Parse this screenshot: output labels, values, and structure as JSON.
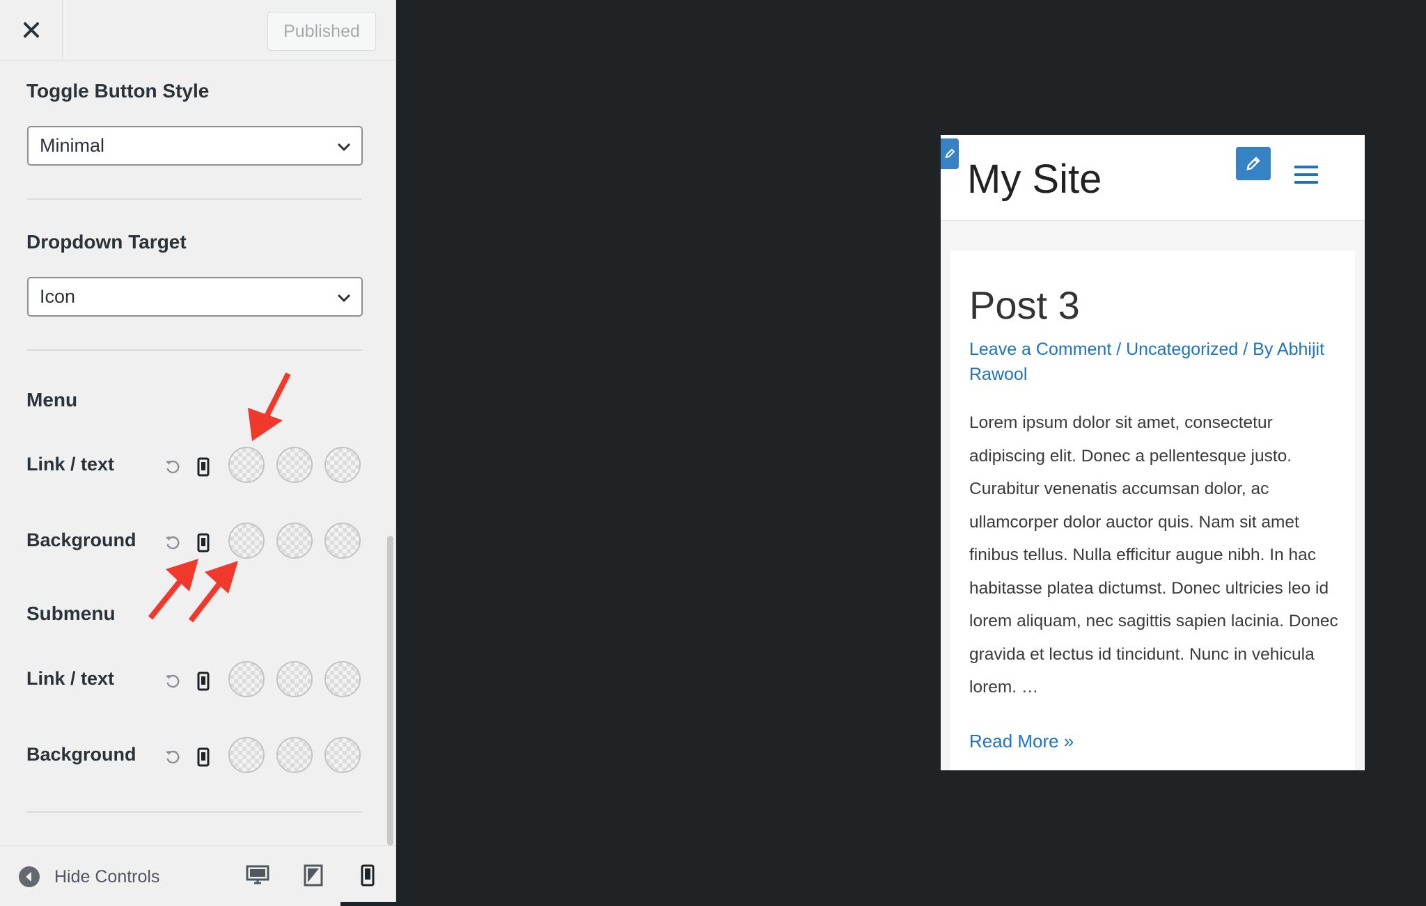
{
  "sidebar": {
    "close_label": "×",
    "publish_label": "Published",
    "toggle_style": {
      "title": "Toggle Button Style",
      "value": "Minimal"
    },
    "dropdown_target": {
      "title": "Dropdown Target",
      "value": "Icon"
    },
    "menu": {
      "heading": "Menu",
      "rows": [
        {
          "label": "Link / text"
        },
        {
          "label": "Background"
        }
      ]
    },
    "submenu": {
      "heading": "Submenu",
      "rows": [
        {
          "label": "Link / text"
        },
        {
          "label": "Background"
        }
      ]
    },
    "footer": {
      "hide_controls_label": "Hide Controls",
      "devices": [
        "desktop-icon",
        "tablet-icon",
        "mobile-icon"
      ],
      "active_device": "mobile"
    }
  },
  "preview": {
    "site_title": "My Site",
    "post": {
      "title": "Post 3",
      "meta_comment": "Leave a Comment",
      "meta_sep1": " / ",
      "meta_category": "Uncategorized",
      "meta_sep2": " / By ",
      "meta_author": "Abhijit Rawool",
      "excerpt": "Lorem ipsum dolor sit amet, consectetur adipiscing elit. Donec a pellentesque justo. Curabitur venenatis accumsan dolor, ac ullamcorper dolor auctor quis. Nam sit amet finibus tellus. Nulla efficitur augue nibh. In hac habitasse platea dictumst. Donec ultricies leo id lorem aliquam, nec sagittis sapien lacinia. Donec gravida et lectus id tincidunt. Nunc in vehicula lorem. …",
      "read_more": "Read More »"
    }
  },
  "colors": {
    "accent_blue": "#1e73be",
    "edit_blue": "#3582c4",
    "annotation_red": "#f0382b",
    "preview_backdrop": "#1f2326"
  }
}
